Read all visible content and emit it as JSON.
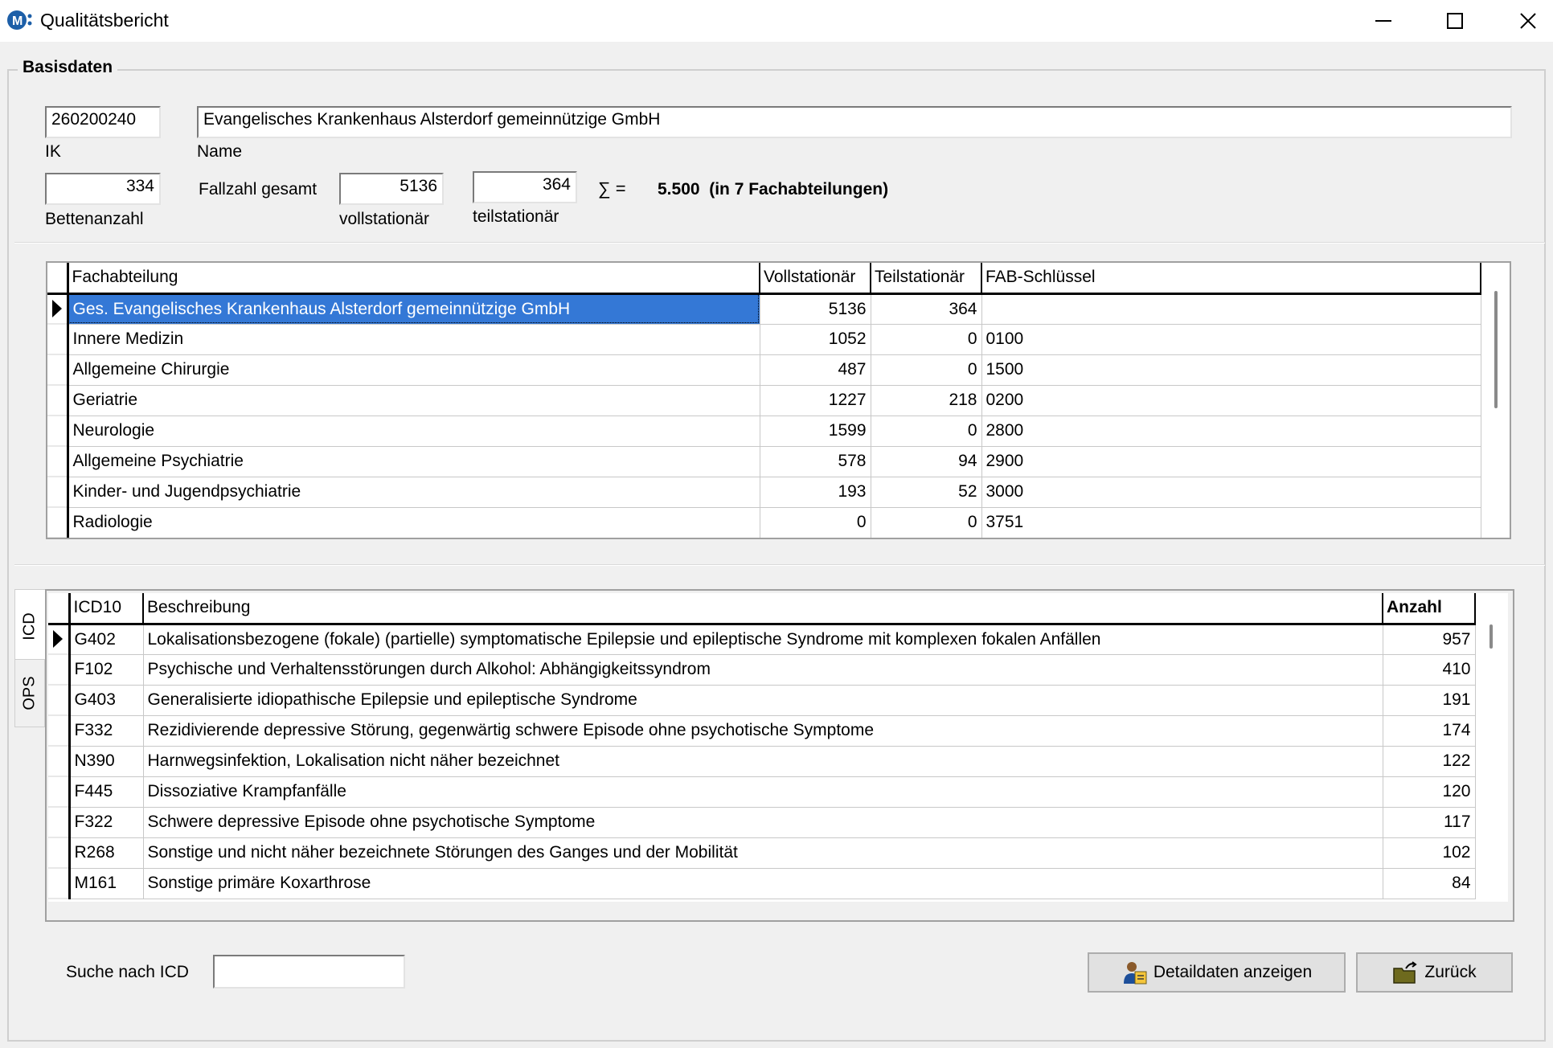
{
  "window": {
    "title": "Qualitätsbericht"
  },
  "basisdaten": {
    "group_title": "Basisdaten",
    "ik_value": "260200240",
    "ik_label": "IK",
    "name_value": "Evangelisches Krankenhaus Alsterdorf gemeinnützige GmbH",
    "name_label": "Name",
    "betten_value": "334",
    "betten_label": "Bettenanzahl",
    "fallzahl_label": "Fallzahl gesamt",
    "voll_value": "5136",
    "voll_label": "vollstationär",
    "teil_value": "364",
    "teil_label": "teilstationär",
    "sum_symbol": "∑ =",
    "sum_text": "5.500  (in 7 Fachabteilungen)"
  },
  "fachabteilungen": {
    "columns": [
      "Fachabteilung",
      "Vollstationär",
      "Teilstationär",
      "FAB-Schlüssel"
    ],
    "rows": [
      {
        "name": "Ges. Evangelisches Krankenhaus Alsterdorf gemeinnützige GmbH",
        "voll": "5136",
        "teil": "364",
        "fab": ""
      },
      {
        "name": "Innere Medizin",
        "voll": "1052",
        "teil": "0",
        "fab": "0100"
      },
      {
        "name": "Allgemeine Chirurgie",
        "voll": "487",
        "teil": "0",
        "fab": "1500"
      },
      {
        "name": "Geriatrie",
        "voll": "1227",
        "teil": "218",
        "fab": "0200"
      },
      {
        "name": "Neurologie",
        "voll": "1599",
        "teil": "0",
        "fab": "2800"
      },
      {
        "name": "Allgemeine Psychiatrie",
        "voll": "578",
        "teil": "94",
        "fab": "2900"
      },
      {
        "name": "Kinder- und Jugendpsychiatrie",
        "voll": "193",
        "teil": "52",
        "fab": "3000"
      },
      {
        "name": "Radiologie",
        "voll": "0",
        "teil": "0",
        "fab": "3751"
      }
    ]
  },
  "tabs": [
    {
      "label": "ICD",
      "active": true
    },
    {
      "label": "OPS",
      "active": false
    }
  ],
  "icd": {
    "columns": [
      "ICD10",
      "Beschreibung",
      "Anzahl"
    ],
    "rows": [
      {
        "code": "G402",
        "desc": "Lokalisationsbezogene (fokale) (partielle) symptomatische Epilepsie und epileptische Syndrome mit komplexen fokalen Anfällen",
        "count": "957"
      },
      {
        "code": "F102",
        "desc": "Psychische und Verhaltensstörungen durch Alkohol: Abhängigkeitssyndrom",
        "count": "410"
      },
      {
        "code": "G403",
        "desc": "Generalisierte idiopathische Epilepsie und epileptische Syndrome",
        "count": "191"
      },
      {
        "code": "F332",
        "desc": "Rezidivierende depressive Störung, gegenwärtig schwere Episode ohne psychotische Symptome",
        "count": "174"
      },
      {
        "code": "N390",
        "desc": "Harnwegsinfektion, Lokalisation nicht näher bezeichnet",
        "count": "122"
      },
      {
        "code": "F445",
        "desc": "Dissoziative Krampfanfälle",
        "count": "120"
      },
      {
        "code": "F322",
        "desc": "Schwere depressive Episode ohne psychotische Symptome",
        "count": "117"
      },
      {
        "code": "R268",
        "desc": "Sonstige und nicht näher bezeichnete Störungen des Ganges und der Mobilität",
        "count": "102"
      },
      {
        "code": "M161",
        "desc": "Sonstige primäre Koxarthrose",
        "count": "84"
      }
    ]
  },
  "search": {
    "label": "Suche nach ICD",
    "value": ""
  },
  "buttons": {
    "details": "Detaildaten anzeigen",
    "back": "Zurück"
  },
  "colors": {
    "selection": "#3478d6"
  }
}
